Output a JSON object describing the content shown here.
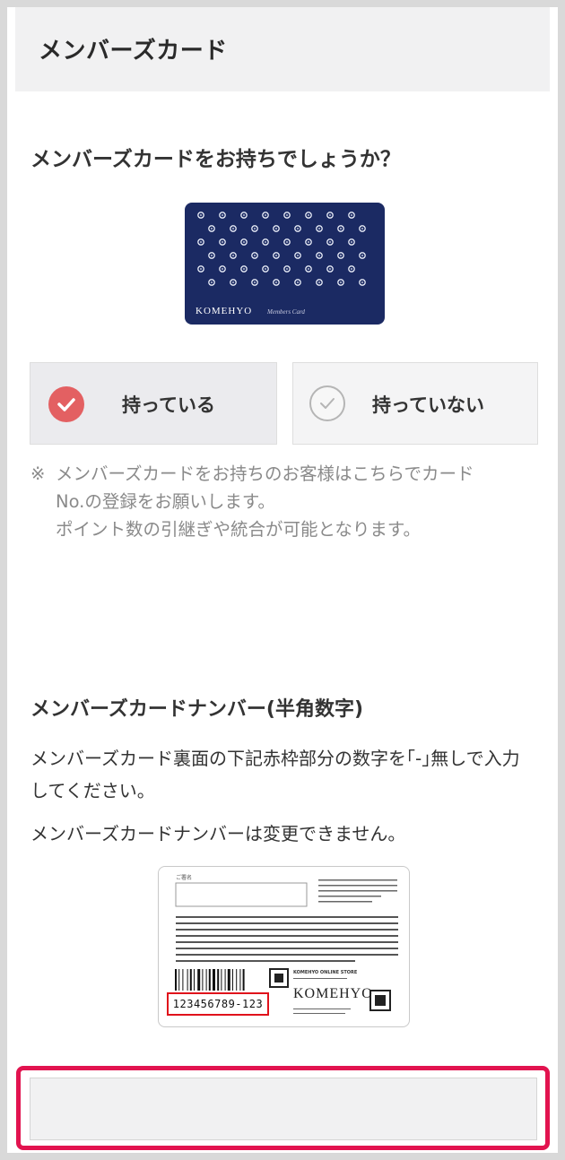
{
  "header": {
    "title": "メンバーズカード"
  },
  "question": "メンバーズカードをお持ちでしょうか？",
  "card": {
    "brand": "KOMEHYO",
    "sub": "Members Card",
    "color": "#1b2a63"
  },
  "options": {
    "yes_label": "持っている",
    "no_label": "持っていない",
    "selected": "yes",
    "accent": "#e36062"
  },
  "note": {
    "mark": "※",
    "lines": [
      "メンバーズカードをお持ちのお客様はこちらでカード",
      "No.の登録をお願いします。",
      "ポイント数の引継ぎや統合が可能となります。"
    ]
  },
  "number_section": {
    "title": "メンバーズカードナンバー(半角数字)",
    "desc": "メンバーズカード裏面の下記赤枠部分の数字を｢-｣無しで入力してください。",
    "desc2": "メンバーズカードナンバーは変更できません。"
  },
  "card_back": {
    "signature_label": "ご署名",
    "card_number": "123456789-123",
    "store_name": "KOMEHYO ONLINE STORE",
    "brand": "KOMEHYO"
  },
  "input": {
    "value": "",
    "highlight_color": "#e2134f"
  }
}
